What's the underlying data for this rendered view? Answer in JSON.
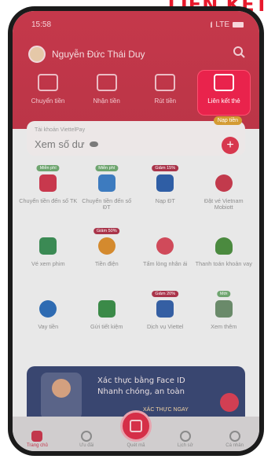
{
  "banner": {
    "title": "LIÊN KẾT"
  },
  "status": {
    "time": "15:58",
    "network": "LTE"
  },
  "user": {
    "name": "Nguyễn Đức Thái Duy"
  },
  "quick_actions": [
    {
      "label": "Chuyển tiền",
      "icon": "transfer-icon",
      "active": false
    },
    {
      "label": "Nhận tiền",
      "icon": "receive-money-icon",
      "active": false
    },
    {
      "label": "Rút tiền",
      "icon": "wallet-icon",
      "active": false
    },
    {
      "label": "Liên kết thẻ",
      "icon": "link-card-icon",
      "active": true
    }
  ],
  "account": {
    "label": "Tài khoản ViettelPay",
    "balance_label": "Xem số dư",
    "topup_badge": "Nạp tiền"
  },
  "services": [
    {
      "label": "Chuyển tiền đến số TK",
      "tag": "Miễn phí",
      "tag_color": "green",
      "icon_color": "#c8384d"
    },
    {
      "label": "Chuyển tiền đến số ĐT",
      "tag": "Miễn phí",
      "tag_color": "green",
      "icon_color": "#3d7bbf"
    },
    {
      "label": "Nạp ĐT",
      "tag": "Giảm 15%",
      "tag_color": "red",
      "icon_color": "#2f5ea5"
    },
    {
      "label": "Đặt vé Vietnam Mobiott",
      "tag": "",
      "tag_color": "",
      "icon_color": "#c23a4c"
    },
    {
      "label": "Vé xem phim",
      "tag": "",
      "tag_color": "",
      "icon_color": "#3b8a54"
    },
    {
      "label": "Tiền điện",
      "tag": "Giảm 50%",
      "tag_color": "red",
      "icon_color": "#d48a2e"
    },
    {
      "label": "Tấm lòng nhân ái",
      "tag": "",
      "tag_color": "",
      "icon_color": "#d04a5a"
    },
    {
      "label": "Thanh toán khoản vay",
      "tag": "",
      "tag_color": "",
      "icon_color": "#4b8a3f"
    },
    {
      "label": "Vay tiền",
      "tag": "",
      "tag_color": "",
      "icon_color": "#2e6bb2"
    },
    {
      "label": "Gửi tiết kiệm",
      "tag": "",
      "tag_color": "",
      "icon_color": "#3b8a48"
    },
    {
      "label": "Dịch vụ Viettel",
      "tag": "Giảm 20%",
      "tag_color": "red",
      "icon_color": "#355fa3"
    },
    {
      "label": "Xem thêm",
      "tag": "Mới",
      "tag_color": "green",
      "icon_color": "#6a8a6a"
    }
  ],
  "promo": {
    "line1": "Xác thực bằng Face ID",
    "line2": "Nhanh chóng, an toàn",
    "cta": "XÁC THỰC NGAY"
  },
  "nav": [
    {
      "label": "Trang chủ",
      "icon": "home-icon"
    },
    {
      "label": "Ưu đãi",
      "icon": "gift-icon"
    },
    {
      "label": "Quét mã",
      "icon": "qr-scan-icon"
    },
    {
      "label": "Lịch sử",
      "icon": "history-icon"
    },
    {
      "label": "Cá nhân",
      "icon": "profile-icon"
    }
  ]
}
